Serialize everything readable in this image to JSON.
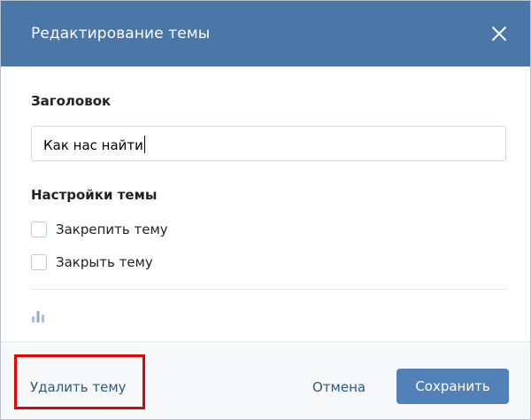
{
  "dialog": {
    "title": "Редактирование темы",
    "close_icon": "close-icon"
  },
  "form": {
    "title_label": "Заголовок",
    "title_value": "Как нас найти",
    "settings_label": "Настройки темы",
    "options": [
      {
        "label": "Закрепить тему",
        "checked": false
      },
      {
        "label": "Закрыть тему",
        "checked": false
      }
    ],
    "poll_icon": "poll-chart-icon"
  },
  "footer": {
    "delete_label": "Удалить тему",
    "cancel_label": "Отмена",
    "save_label": "Сохранить"
  },
  "colors": {
    "header": "#4a76a8",
    "primary_button": "#5181b8",
    "link": "#2a5885",
    "highlight": "#e60000"
  }
}
